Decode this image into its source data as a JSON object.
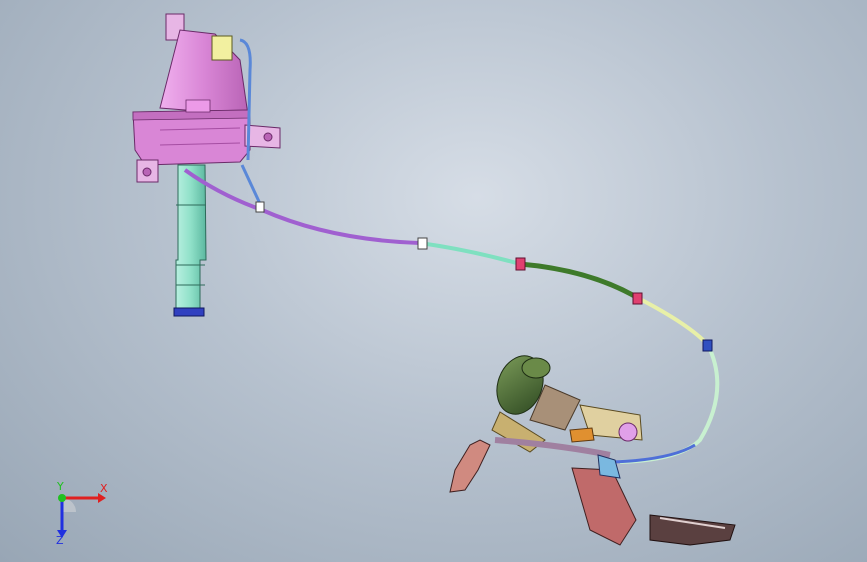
{
  "viewport": {
    "background_top": "#d6dde6",
    "background_bottom": "#98a6b5"
  },
  "triad": {
    "x_label": "X",
    "y_label": "Y",
    "z_label": "Z",
    "x_color": "#e02020",
    "y_color": "#20c020",
    "z_color": "#2030e0"
  },
  "parts": {
    "reservoir_color": "#d986d6",
    "pump_tube_color": "#8fe0c8",
    "motor_color": "#4d6a38",
    "hose_colors": [
      "#b46bd6",
      "#7fe0c0",
      "#3e7a2a",
      "#e8f0a8",
      "#4f6fd8"
    ],
    "clip_colors": [
      "#e04070",
      "#e04070",
      "#3050c0"
    ]
  }
}
